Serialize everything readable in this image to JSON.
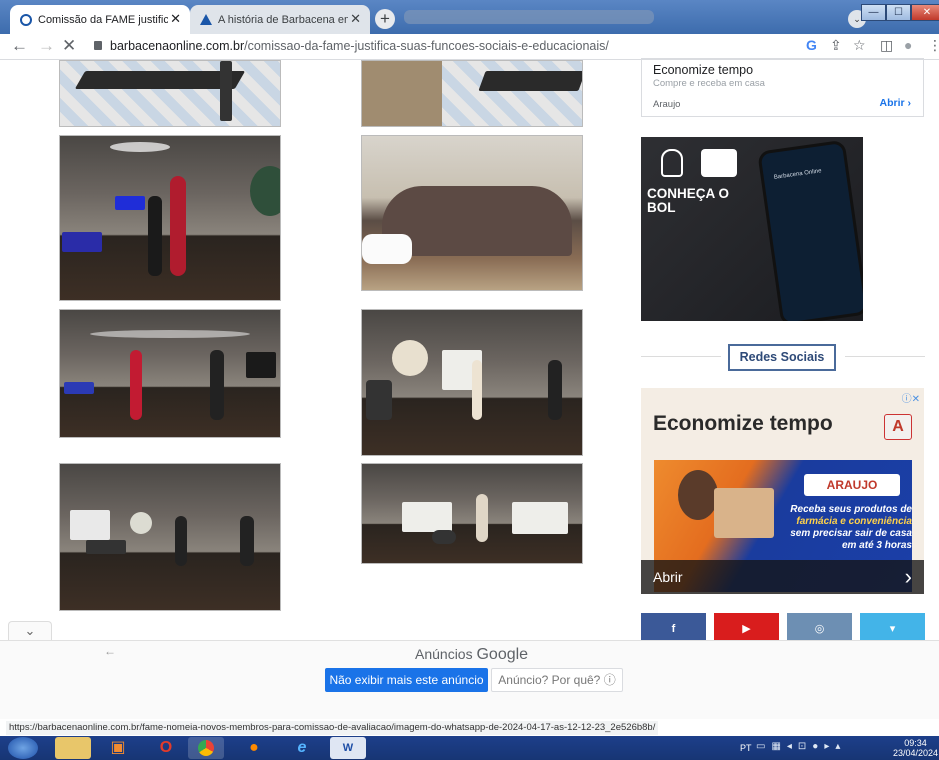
{
  "tabs": [
    {
      "title": "Comissão da FAME justifica suas",
      "close": "✕",
      "active": true
    },
    {
      "title": "A história de Barbacena em foto",
      "close": "✕",
      "active": false
    }
  ],
  "new_tab": "+",
  "window": {
    "minimize": "—",
    "maximize": "☐",
    "close": "✕"
  },
  "address": {
    "domain": "barbacenaonline.com.br",
    "path": "/comissao-da-fame-justifica-suas-funcoes-sociais-e-educacionais/"
  },
  "toolbar": {
    "google": "G",
    "share": "⇪",
    "star": "☆",
    "sidepanel": "◫",
    "profile": "●",
    "menu": "⋮"
  },
  "ad_top": {
    "title": "Economize tempo",
    "subtitle": "Compre e receba em casa",
    "brand": "Araujo",
    "cta": "Abrir ›"
  },
  "promo": {
    "headline_1": "CONHEÇA O",
    "headline_2": "BOL",
    "phone_title": "Barbacena Online"
  },
  "redes_sociais": "Redes Sociais",
  "ad_right": {
    "headline": "Economize tempo",
    "logo": "A",
    "cta": "Abrir",
    "cta_arrow": "›",
    "close": "ⓘ✕",
    "brand_box": "ARAUJO",
    "copy_1": "Receba seus produtos de",
    "copy_2": "farmácia e conveniência",
    "copy_3": "sem precisar sair de casa",
    "copy_4": "em até 3 horas"
  },
  "social": [
    {
      "name": "facebook",
      "glyph": "f",
      "color": "#3b5998"
    },
    {
      "name": "youtube",
      "glyph": "▶",
      "color": "#d91d1d"
    },
    {
      "name": "instagram",
      "glyph": "◎",
      "color": "#6d8fb3"
    },
    {
      "name": "twitter",
      "glyph": "▾",
      "color": "#43b4e8"
    }
  ],
  "ad_overlay": {
    "toggle": "⌄",
    "back": "←",
    "label": "Anúncios",
    "brand": "Google",
    "no_show": "Não exibir mais este anúncio",
    "why": "Anúncio? Por quê? ⓘ"
  },
  "status_url": "https://barbacenaonline.com.br/fame-nomeia-novos-membros-para-comissao-de-avaliacao/imagem-do-whatsapp-de-2024-04-17-as-12-12-23_2e526b8b/",
  "taskbar": {
    "lang": "PT",
    "time": "09:34",
    "date": "23/04/2024"
  }
}
